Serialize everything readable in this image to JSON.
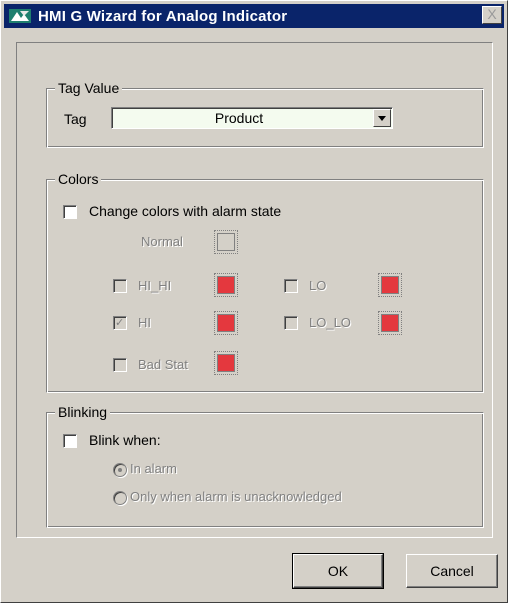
{
  "window": {
    "title": "HMI G Wizard for Analog Indicator",
    "close_label": "X",
    "icon": "app-icon"
  },
  "tag_value": {
    "legend": "Tag Value",
    "tag_label": "Tag",
    "tag_selected": "Product"
  },
  "colors": {
    "legend": "Colors",
    "change_colors_label": "Change colors with alarm state",
    "change_colors_checked": false,
    "normal_label": "Normal",
    "alarms": {
      "hi_hi": {
        "label": "HI_HI",
        "checked": false
      },
      "hi": {
        "label": "HI",
        "checked": true
      },
      "bad_stat": {
        "label": "Bad Stat",
        "checked": false
      },
      "lo": {
        "label": "LO",
        "checked": false
      },
      "lo_lo": {
        "label": "LO_LO",
        "checked": false
      }
    },
    "alarm_color": "#e4383e",
    "normal_color": "#d4d0c8"
  },
  "blinking": {
    "legend": "Blinking",
    "blink_label": "Blink when:",
    "blink_checked": false,
    "options": [
      {
        "label": "In alarm",
        "selected": true
      },
      {
        "label": "Only when alarm is unacknowledged",
        "selected": false
      }
    ]
  },
  "buttons": {
    "ok": "OK",
    "cancel": "Cancel"
  }
}
